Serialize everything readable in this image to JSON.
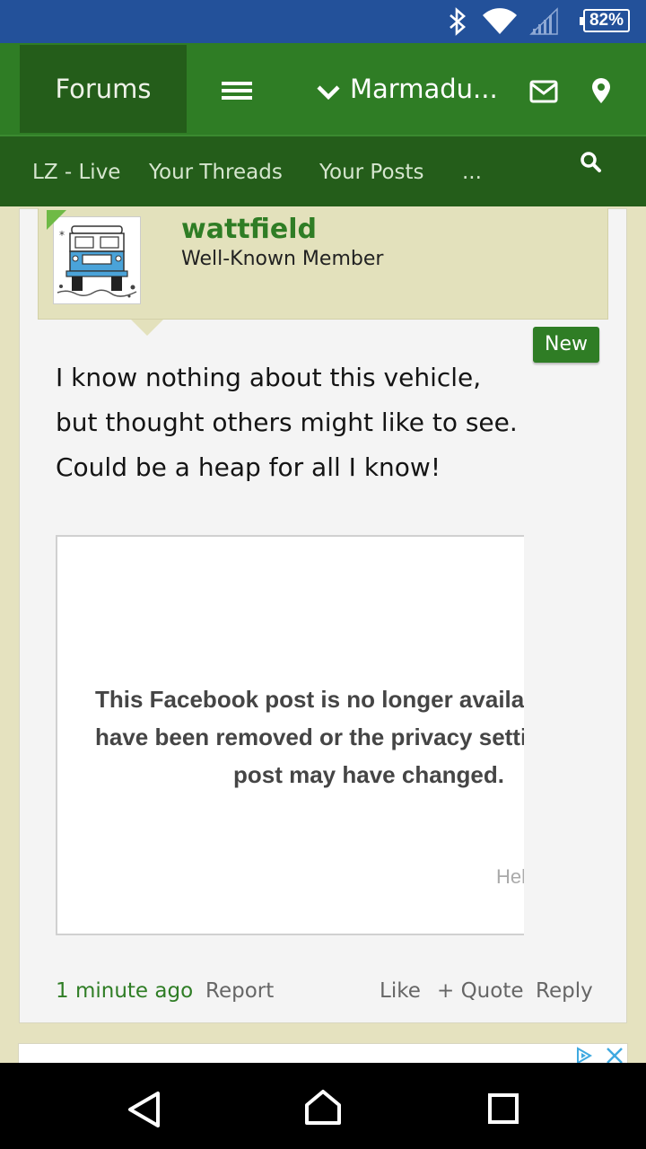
{
  "status_bar": {
    "battery": "82%",
    "icons": [
      "bluetooth-icon",
      "wifi-icon",
      "signal-icon",
      "battery-icon"
    ],
    "color": "#23519a"
  },
  "nav": {
    "forums_label": "Forums",
    "user_label": "Marmadu...",
    "icons": [
      "menu-icon",
      "chevron-down-icon",
      "mail-icon",
      "location-pin-icon"
    ],
    "color": "#2f7d25",
    "active_color": "#245d1a"
  },
  "subnav": {
    "items": [
      "LZ - Live",
      "Your Threads",
      "Your Posts",
      "..."
    ],
    "search_icon": "search-icon"
  },
  "post": {
    "username": "wattfield",
    "user_title": "Well-Known Member",
    "badge": "New",
    "body_lines": [
      "I know nothing about this vehicle,",
      "but thought others might like to see.",
      "Could be a heap for all I know!"
    ],
    "embed": {
      "message_lines": [
        "This Facebook post is no longer available. It may",
        "have been removed or the privacy settings of the",
        "post may have changed."
      ],
      "help_link": "Help"
    },
    "timestamp": "1 minute ago",
    "report": "Report",
    "like": "Like",
    "quote": "+ Quote",
    "reply": "Reply"
  },
  "ad": {
    "icons": [
      "ad-choices-icon",
      "close-icon"
    ]
  },
  "android_nav": {
    "icons": [
      "back-icon",
      "home-icon",
      "recents-icon"
    ]
  }
}
